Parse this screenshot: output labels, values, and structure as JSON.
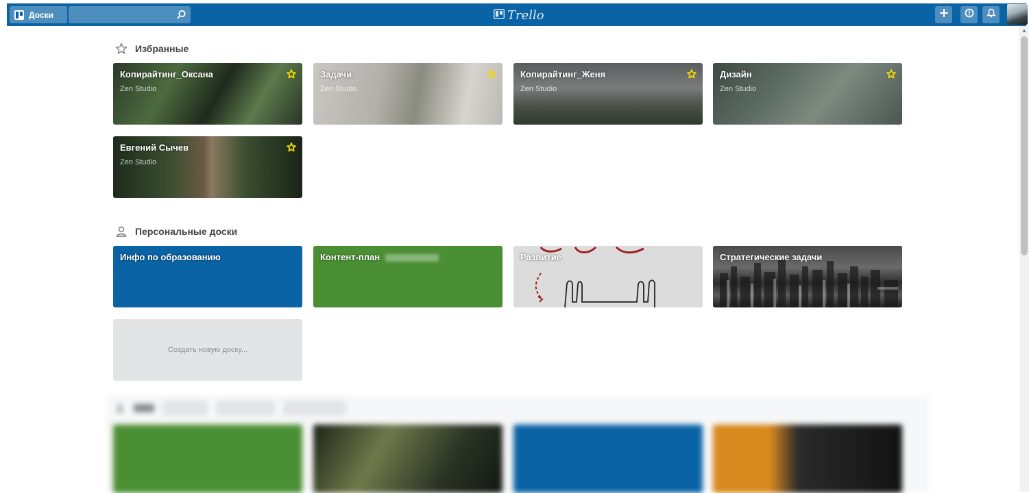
{
  "header": {
    "boards_label": "Доски",
    "search_value": "",
    "logo_text": "Trello"
  },
  "favorites": {
    "title": "Избранные",
    "boards": [
      {
        "title": "Копирайтинг_Оксана",
        "org": "Zen Studio",
        "starred": true
      },
      {
        "title": "Задачи",
        "org": "Zen Studio",
        "starred": true
      },
      {
        "title": "Копирайтинг_Женя",
        "org": "Zen Studio",
        "starred": true
      },
      {
        "title": "Дизайн",
        "org": "Zen Studio",
        "starred": true
      },
      {
        "title": "Евгений Сычев",
        "org": "Zen Studio",
        "starred": true
      }
    ]
  },
  "personal": {
    "title": "Персональные доски",
    "boards": [
      {
        "title": "Инфо по образованию",
        "color": "#0a63a5"
      },
      {
        "title": "Контент-план",
        "color": "#4b8f34"
      },
      {
        "title": "Развитие",
        "color": "#d6d6d6"
      },
      {
        "title": "Стратегические задачи",
        "color": "#3c3c3c"
      }
    ],
    "create_label": "Создать новую доску..."
  },
  "colors": {
    "header_bg": "#0a63a5",
    "star": "#f2d600",
    "green": "#4b8f34",
    "blue": "#0a63a5",
    "orange": "#d98a1e"
  },
  "icons": {
    "boards": "boards-icon",
    "search": "search-icon",
    "add": "plus-icon",
    "info": "info-icon",
    "notifications": "bell-icon",
    "favorites": "star-outline-icon",
    "personal": "person-icon",
    "star": "star-icon"
  }
}
